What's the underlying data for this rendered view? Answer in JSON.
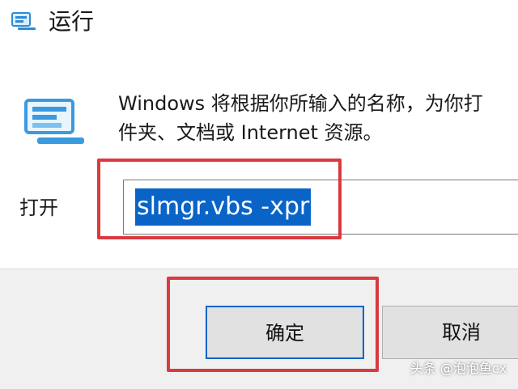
{
  "window": {
    "title": "运行"
  },
  "main": {
    "description_line1": "Windows 将根据你所输入的名称，为你打",
    "description_line2": "件夹、文档或 Internet 资源。",
    "open_label": "打开",
    "command_value": "slmgr.vbs -xpr"
  },
  "buttons": {
    "ok_label": "确定",
    "cancel_label": "取消"
  },
  "watermark": "头条 @泡泡鱼cx",
  "colors": {
    "highlight_red": "#d93a3f",
    "selection_blue": "#0a64c8",
    "footer_gray": "#f0f0f0"
  },
  "icons": {
    "title_icon": "run-dialog-icon",
    "body_icon": "run-program-icon"
  }
}
